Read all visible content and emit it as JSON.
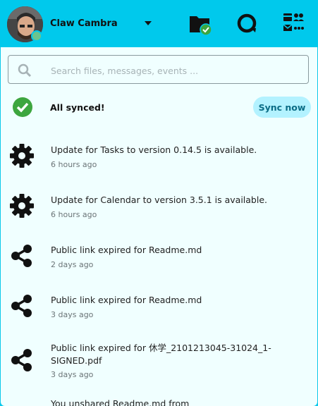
{
  "header": {
    "user_name": "Claw Cambra",
    "files_icon": "folder-check-icon",
    "talk_icon": "talk-icon",
    "apps_icon": "apps-icon"
  },
  "search": {
    "placeholder": "Search files, messages, events ..."
  },
  "sync": {
    "status": "All synced!",
    "button_label": "Sync now"
  },
  "activities": [
    {
      "icon": "gear-icon",
      "title": "Update for Tasks to version 0.14.5 is available.",
      "time": "6 hours ago"
    },
    {
      "icon": "gear-icon",
      "title": "Update for Calendar to version 3.5.1 is available.",
      "time": "6 hours ago"
    },
    {
      "icon": "share-icon",
      "title": "Public link expired for Readme.md",
      "time": "2 days ago"
    },
    {
      "icon": "share-icon",
      "title": "Public link expired for Readme.md",
      "time": "3 days ago"
    },
    {
      "icon": "share-icon",
      "title": "Public link expired for 休学_2101213045-31024_1-SIGNED.pdf",
      "time": "3 days ago"
    },
    {
      "icon": "share-icon",
      "title": "You unshared Readme.md from",
      "time": ""
    }
  ],
  "colors": {
    "header": "#00c9ec",
    "panel": "#f0ffff",
    "check": "#3da63f",
    "sync_button": "#b3f2ff"
  }
}
